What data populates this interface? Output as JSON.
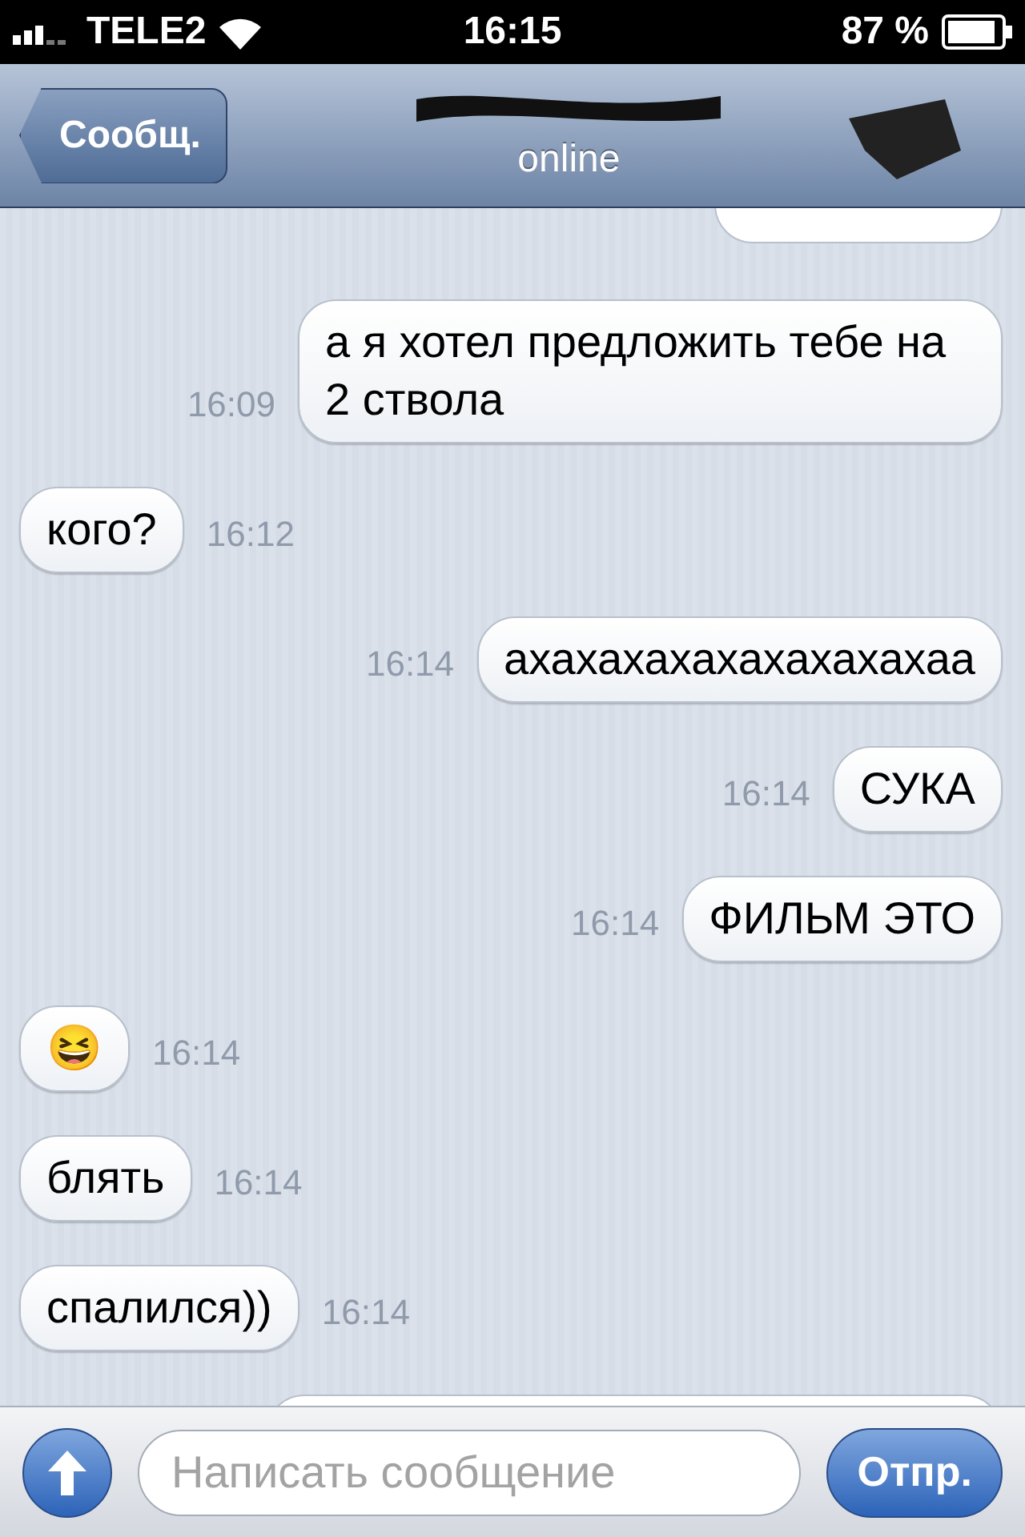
{
  "status_bar": {
    "carrier": "TELE2",
    "time": "16:15",
    "battery": "87 %"
  },
  "nav": {
    "back": "Сообщ.",
    "subtitle": "online"
  },
  "messages": [
    {
      "kind": "outgoing",
      "text": "а я хотел предложить тебе на 2 ствола",
      "time": "16:09"
    },
    {
      "kind": "incoming",
      "text": "кого?",
      "time": "16:12"
    },
    {
      "kind": "outgoing",
      "text": "ахахахахахахахахахаа",
      "time": "16:14"
    },
    {
      "kind": "outgoing",
      "text": "СУКА",
      "time": "16:14"
    },
    {
      "kind": "outgoing",
      "text": "ФИЛЬМ ЭТО",
      "time": "16:14"
    },
    {
      "kind": "incoming",
      "text": "😆",
      "time": "16:14"
    },
    {
      "kind": "incoming",
      "text": "блять",
      "time": "16:14"
    },
    {
      "kind": "incoming",
      "text": "спалился))",
      "time": "16:14"
    }
  ],
  "composer": {
    "placeholder": "Написать сообщение",
    "send": "Отпр."
  }
}
